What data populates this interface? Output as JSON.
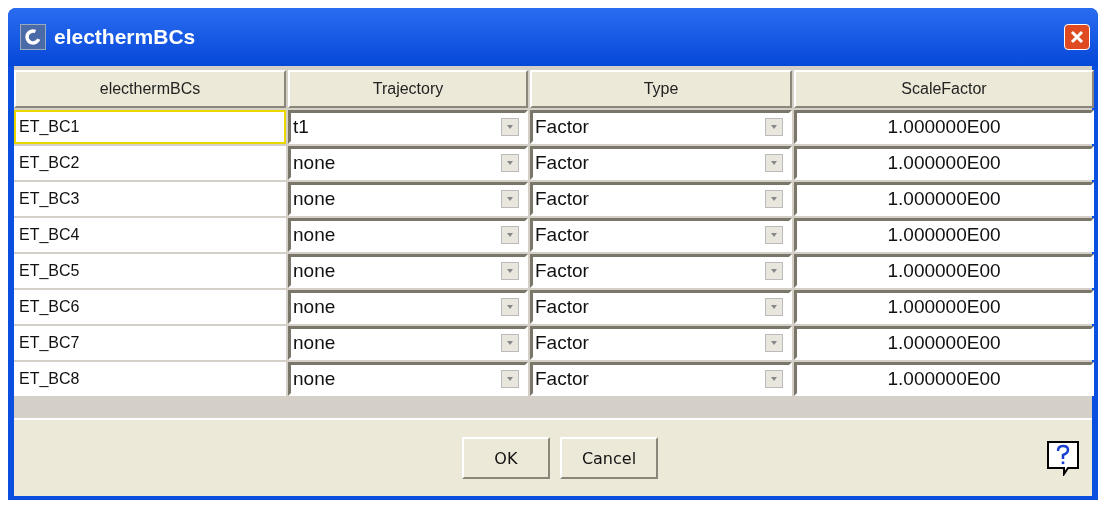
{
  "window": {
    "title": "electhermBCs"
  },
  "table": {
    "columns": [
      "electhermBCs",
      "Trajectory",
      "Type",
      "ScaleFactor"
    ],
    "rows": [
      {
        "name": "ET_BC1",
        "focused": true,
        "trajectory": "t1",
        "type": "Factor",
        "scale_factor": "1.000000E00"
      },
      {
        "name": "ET_BC2",
        "focused": false,
        "trajectory": "none",
        "type": "Factor",
        "scale_factor": "1.000000E00"
      },
      {
        "name": "ET_BC3",
        "focused": false,
        "trajectory": "none",
        "type": "Factor",
        "scale_factor": "1.000000E00"
      },
      {
        "name": "ET_BC4",
        "focused": false,
        "trajectory": "none",
        "type": "Factor",
        "scale_factor": "1.000000E00"
      },
      {
        "name": "ET_BC5",
        "focused": false,
        "trajectory": "none",
        "type": "Factor",
        "scale_factor": "1.000000E00"
      },
      {
        "name": "ET_BC6",
        "focused": false,
        "trajectory": "none",
        "type": "Factor",
        "scale_factor": "1.000000E00"
      },
      {
        "name": "ET_BC7",
        "focused": false,
        "trajectory": "none",
        "type": "Factor",
        "scale_factor": "1.000000E00"
      },
      {
        "name": "ET_BC8",
        "focused": false,
        "trajectory": "none",
        "type": "Factor",
        "scale_factor": "1.000000E00"
      }
    ]
  },
  "buttons": [
    "OK",
    "Cancel"
  ]
}
